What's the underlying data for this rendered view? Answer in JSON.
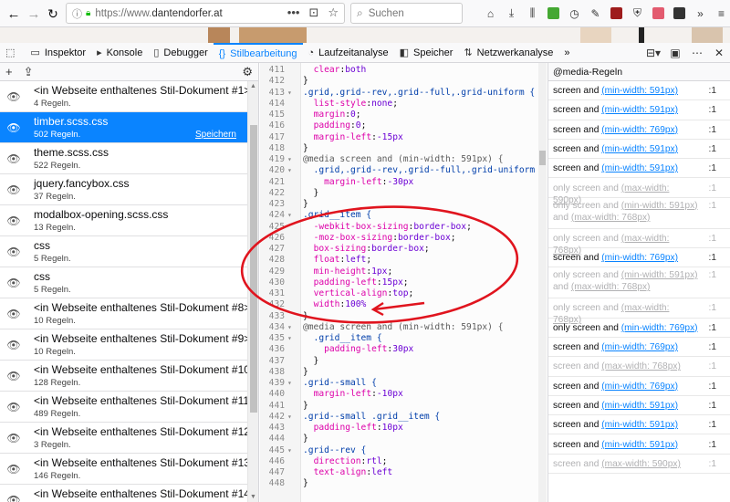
{
  "browser": {
    "url_prefix": "https://www.",
    "url_domain": "dantendorfer.at",
    "url_dots": "•••",
    "search_placeholder": "Suchen"
  },
  "devtools": {
    "tabs": [
      {
        "label": "Inspektor",
        "icon": "inspector-icon"
      },
      {
        "label": "Konsole",
        "icon": "console-icon"
      },
      {
        "label": "Debugger",
        "icon": "debugger-icon"
      },
      {
        "label": "Stilbearbeitung",
        "icon": "style-editor-icon",
        "selected": true
      },
      {
        "label": "Laufzeitanalyse",
        "icon": "performance-icon"
      },
      {
        "label": "Speicher",
        "icon": "memory-icon"
      },
      {
        "label": "Netzwerkanalyse",
        "icon": "network-icon"
      }
    ],
    "overflow": "»"
  },
  "sheets": [
    {
      "name": "<in Webseite enthaltenes Stil-Dokument #1>",
      "rules": "4 Regeln."
    },
    {
      "name": "timber.scss.css",
      "rules": "502 Regeln.",
      "save": "Speichern",
      "selected": true
    },
    {
      "name": "theme.scss.css",
      "rules": "522 Regeln."
    },
    {
      "name": "jquery.fancybox.css",
      "rules": "37 Regeln."
    },
    {
      "name": "modalbox-opening.scss.css",
      "rules": "13 Regeln."
    },
    {
      "name": "css",
      "rules": "5 Regeln."
    },
    {
      "name": "css",
      "rules": "5 Regeln."
    },
    {
      "name": "<in Webseite enthaltenes Stil-Dokument #8>",
      "rules": "10 Regeln."
    },
    {
      "name": "<in Webseite enthaltenes Stil-Dokument #9>",
      "rules": "10 Regeln."
    },
    {
      "name": "<in Webseite enthaltenes Stil-Dokument #10>",
      "rules": "128 Regeln."
    },
    {
      "name": "<in Webseite enthaltenes Stil-Dokument #11>",
      "rules": "489 Regeln."
    },
    {
      "name": "<in Webseite enthaltenes Stil-Dokument #12>",
      "rules": "3 Regeln."
    },
    {
      "name": "<in Webseite enthaltenes Stil-Dokument #13>",
      "rules": "146 Regeln."
    },
    {
      "name": "<in Webseite enthaltenes Stil-Dokument #14>",
      "rules": "4 Regeln."
    }
  ],
  "code": [
    {
      "n": "411",
      "t": "  clear:both"
    },
    {
      "n": "412",
      "t": "}"
    },
    {
      "n": "413",
      "f": "▾",
      "t": ".grid,.grid--rev,.grid--full,.grid-uniform {"
    },
    {
      "n": "414",
      "t": "  list-style:none;"
    },
    {
      "n": "415",
      "t": "  margin:0;"
    },
    {
      "n": "416",
      "t": "  padding:0;"
    },
    {
      "n": "417",
      "t": "  margin-left:-15px"
    },
    {
      "n": "418",
      "t": "}"
    },
    {
      "n": "419",
      "f": "▾",
      "t": "@media screen and (min-width: 591px) {"
    },
    {
      "n": "420",
      "f": "▾",
      "t": "  .grid,.grid--rev,.grid--full,.grid-uniform {"
    },
    {
      "n": "421",
      "t": "    margin-left:-30px"
    },
    {
      "n": "422",
      "t": "  }"
    },
    {
      "n": "423",
      "t": "}"
    },
    {
      "n": "424",
      "f": "▾",
      "t": ".grid__item {"
    },
    {
      "n": "425",
      "t": "  -webkit-box-sizing:border-box;"
    },
    {
      "n": "426",
      "t": "  -moz-box-sizing:border-box;"
    },
    {
      "n": "427",
      "t": "  box-sizing:border-box;"
    },
    {
      "n": "428",
      "t": "  float:left;"
    },
    {
      "n": "429",
      "t": "  min-height:1px;"
    },
    {
      "n": "430",
      "t": "  padding-left:15px;"
    },
    {
      "n": "431",
      "t": "  vertical-align:top;"
    },
    {
      "n": "432",
      "t": "  width:100%"
    },
    {
      "n": "433",
      "t": "}"
    },
    {
      "n": "434",
      "f": "▾",
      "t": "@media screen and (min-width: 591px) {"
    },
    {
      "n": "435",
      "f": "▾",
      "t": "  .grid__item {"
    },
    {
      "n": "436",
      "t": "    padding-left:30px"
    },
    {
      "n": "437",
      "t": "  }"
    },
    {
      "n": "438",
      "t": "}"
    },
    {
      "n": "439",
      "f": "▾",
      "t": ".grid--small {"
    },
    {
      "n": "440",
      "t": "  margin-left:-10px"
    },
    {
      "n": "441",
      "t": "}"
    },
    {
      "n": "442",
      "f": "▾",
      "t": ".grid--small .grid__item {"
    },
    {
      "n": "443",
      "t": "  padding-left:10px"
    },
    {
      "n": "444",
      "t": "}"
    },
    {
      "n": "445",
      "f": "▾",
      "t": ".grid--rev {"
    },
    {
      "n": "446",
      "t": "  direction:rtl;"
    },
    {
      "n": "447",
      "t": "  text-align:left"
    },
    {
      "n": "448",
      "t": "}"
    }
  ],
  "media": {
    "header": "@media-Regeln",
    "items": [
      {
        "pre": "screen and ",
        "q": "(min-width: 591px)",
        "line": ":1"
      },
      {
        "pre": "screen and ",
        "q": "(min-width: 591px)",
        "line": ":1"
      },
      {
        "pre": "screen and ",
        "q": "(min-width: 769px)",
        "line": ":1"
      },
      {
        "pre": "screen and ",
        "q": "(min-width: 591px)",
        "line": ":1"
      },
      {
        "pre": "screen and ",
        "q": "(min-width: 591px)",
        "line": ":1"
      },
      {
        "pre": "only screen and ",
        "q": "(max-width: 590px)",
        "line": ":1",
        "dim": true
      },
      {
        "pre": "only screen and ",
        "q": "(min-width: 591px)",
        "mid": " and ",
        "q2": "(max-width: 768px)",
        "line": ":1",
        "dim": true
      },
      {
        "pre": "only screen and ",
        "q": "(max-width: 768px)",
        "line": ":1",
        "dim": true
      },
      {
        "pre": "screen and ",
        "q": "(min-width: 769px)",
        "line": ":1"
      },
      {
        "pre": "only screen and ",
        "q": "(min-width: 591px)",
        "mid": " and ",
        "q2": "(max-width: 768px)",
        "line": ":1",
        "dim": true
      },
      {
        "pre": "only screen and ",
        "q": "(max-width: 768px)",
        "line": ":1",
        "dim": true
      },
      {
        "pre": "only screen and ",
        "q": "(min-width: 769px)",
        "line": ":1"
      },
      {
        "pre": "screen and ",
        "q": "(min-width: 769px)",
        "line": ":1"
      },
      {
        "pre": "screen and ",
        "q": "(max-width: 768px)",
        "line": ":1",
        "dim": true
      },
      {
        "pre": "screen and ",
        "q": "(min-width: 769px)",
        "line": ":1"
      },
      {
        "pre": "screen and ",
        "q": "(min-width: 591px)",
        "line": ":1"
      },
      {
        "pre": "screen and ",
        "q": "(min-width: 591px)",
        "line": ":1"
      },
      {
        "pre": "screen and ",
        "q": "(min-width: 591px)",
        "line": ":1"
      },
      {
        "pre": "screen and ",
        "q": "(max-width: 590px)",
        "line": ":1",
        "dim": true
      }
    ]
  },
  "colors": {
    "accent": "#0a84ff",
    "annotation": "#e0141e"
  }
}
